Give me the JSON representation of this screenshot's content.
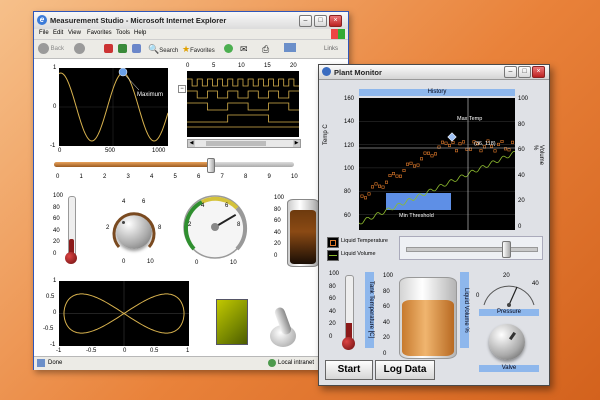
{
  "colors": {
    "accent": "#8eb7ec",
    "plot_bg": "#000000",
    "trace": "#d8b24e"
  },
  "ie": {
    "title": "Measurement Studio - Microsoft Internet Explorer",
    "menus": [
      "File",
      "Edit",
      "View",
      "Favorites",
      "Tools",
      "Help"
    ],
    "toolbar": {
      "back": "Back",
      "search": "Search",
      "favorites": "Favorites",
      "links": "Links"
    },
    "status": {
      "left": "Done",
      "right": "Local intranet"
    }
  },
  "graph1": {
    "xticks": [
      "0",
      "500",
      "1000"
    ],
    "yticks": [
      "1",
      "0",
      "-1"
    ],
    "marker": "Maximum"
  },
  "digital": {
    "xticks": [
      "0",
      "5",
      "10",
      "15",
      "20"
    ]
  },
  "slide": {
    "ticks": [
      "0",
      "1",
      "2",
      "3",
      "4",
      "5",
      "6",
      "7",
      "8",
      "9",
      "10"
    ],
    "value": 0.65
  },
  "thermo1": {
    "ticks": [
      "100",
      "80",
      "60",
      "40",
      "20",
      "0"
    ],
    "value": 0.3
  },
  "knob1": {
    "ticks": [
      "0",
      "2",
      "4",
      "6",
      "8",
      "10"
    ]
  },
  "gauge1": {
    "ticks": [
      "0",
      "2",
      "4",
      "6",
      "8",
      "10"
    ],
    "value": 0.72
  },
  "tank1": {
    "ticks": [
      "100",
      "80",
      "60",
      "40",
      "20",
      "0"
    ]
  },
  "xy": {
    "xticks": [
      "-1",
      "-0.5",
      "0",
      "0.5",
      "1"
    ],
    "yticks": [
      "1",
      "0.5",
      "0",
      "-0.5",
      "-1"
    ]
  },
  "pm": {
    "title": "Plant Monitor",
    "history_label": "History",
    "temp_axis": "Temp C",
    "vol_axis": "Volume %",
    "temp_ticks": [
      "160",
      "140",
      "120",
      "100",
      "80",
      "60"
    ],
    "vol_ticks": [
      "100",
      "80",
      "60",
      "40",
      "20",
      "0"
    ],
    "max_temp": "Max Temp",
    "cursor_readout": "(36, 118)",
    "min_threshold": "Min Threshold",
    "legend": [
      "Liquid Temperature",
      "Liquid Volume"
    ],
    "slider_value": 0.74,
    "thermo_ticks": [
      "100",
      "80",
      "60",
      "40",
      "20",
      "0"
    ],
    "thermo_label": "Tank Temperature [C]",
    "tank_ticks": [
      "100",
      "80",
      "60",
      "40",
      "20",
      "0"
    ],
    "tank_label": "Liquid Volume %",
    "pressure_ticks": [
      "0",
      "20",
      "40"
    ],
    "pressure_label": "Pressure",
    "valve_label": "Valve",
    "start": "Start",
    "log": "Log Data"
  }
}
